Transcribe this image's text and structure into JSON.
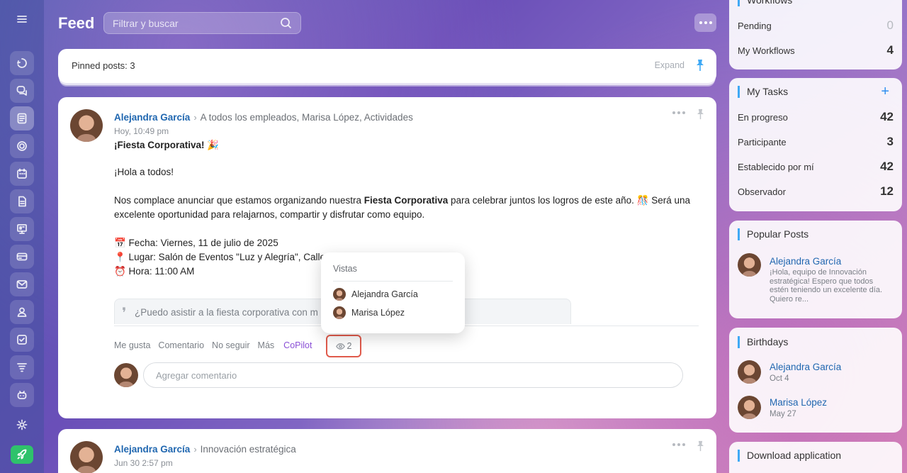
{
  "header": {
    "title": "Feed",
    "search_placeholder": "Filtrar y buscar"
  },
  "pinned": {
    "label": "Pinned posts: 3",
    "expand": "Expand"
  },
  "post": {
    "author": "Alejandra García",
    "destinations": "A todos los empleados, Marisa López, Actividades",
    "time": "Hoy, 10:49 pm",
    "title": "¡Fiesta Corporativa! 🎉",
    "greeting": "¡Hola a todos!",
    "paragraph_before": "Nos complace anunciar que estamos organizando nuestra ",
    "paragraph_bold": "Fiesta Corporativa",
    "paragraph_after": " para celebrar juntos los logros de este año. 🎊 Será una excelente oportunidad para relajarnos, compartir y disfrutar como equipo.",
    "date_line": "📅 Fecha: Viernes, 11 de julio de 2025",
    "place_line": "📍 Lugar: Salón de Eventos \"Luz y Alegría\", Calle",
    "hour_line": "⏰ Hora: 11:00 AM",
    "quote": "¿Puedo asistir a la fiesta corporativa con m",
    "actions": {
      "like": "Me gusta",
      "comment": "Comentario",
      "unfollow": "No seguir",
      "more": "Más",
      "copilot": "CoPilot",
      "views": "2"
    },
    "comment_placeholder": "Agregar comentario"
  },
  "views_popover": {
    "title": "Vistas",
    "viewers": [
      "Alejandra García",
      "Marisa López"
    ]
  },
  "post2": {
    "author": "Alejandra García",
    "destination": "Innovación estratégica",
    "time": "Jun 30 2:57 pm"
  },
  "workflows": {
    "title": "Workflows",
    "rows": [
      {
        "label": "Pending",
        "count": "0"
      },
      {
        "label": "My Workflows",
        "count": "4"
      }
    ]
  },
  "tasks": {
    "title": "My Tasks",
    "add": "+",
    "rows": [
      {
        "label": "En progreso",
        "count": "42"
      },
      {
        "label": "Participante",
        "count": "3"
      },
      {
        "label": "Establecido por mí",
        "count": "42"
      },
      {
        "label": "Observador",
        "count": "12"
      }
    ]
  },
  "popular": {
    "title": "Popular Posts",
    "author": "Alejandra García",
    "excerpt": "¡Hola, equipo de Innovación estratégica! Espero que todos estén teniendo un excelente día. Quiero re..."
  },
  "birthdays": {
    "title": "Birthdays",
    "people": [
      {
        "name": "Alejandra García",
        "date": "Oct 4"
      },
      {
        "name": "Marisa López",
        "date": "May 27"
      }
    ]
  },
  "download": {
    "title": "Download application"
  },
  "colors": {
    "accent": "#2067b0",
    "copilot": "#8a4fd6",
    "highlight": "#e05a4b",
    "rocket": "#2fc26b"
  }
}
